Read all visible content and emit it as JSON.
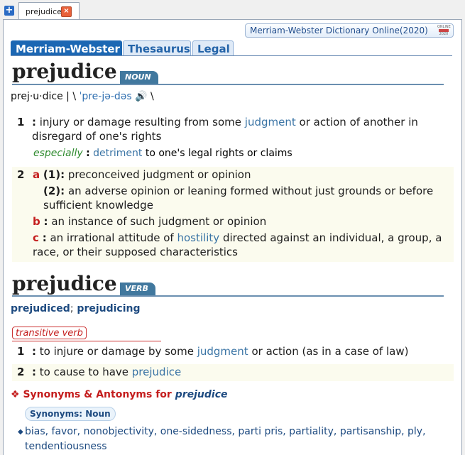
{
  "tabbar": {
    "new_tab_icon": "plus-icon",
    "tab_label": "prejudice",
    "close_icon": "close-icon"
  },
  "source_button": {
    "label": "Merriam-Webster Dictionary Online(2020)",
    "badge_top": "ONLINE",
    "badge_bottom": "2020"
  },
  "dict_tabs": [
    {
      "label": "Merriam-Webster",
      "active": true
    },
    {
      "label": "Thesaurus",
      "active": false
    },
    {
      "label": "Legal",
      "active": false
    }
  ],
  "entry1": {
    "headword": "prejudice",
    "pos": "NOUN",
    "pron": {
      "syllables": "prej·u·dice",
      "sep1": "|",
      "open": "\\",
      "ipa": "ˈpre-jə-dəs",
      "close": "\\",
      "speaker_icon": "speaker-icon"
    },
    "sense1": {
      "num": "1",
      "colon": ":",
      "text_before": "injury or damage resulting from some",
      "link": "judgment",
      "text_after": "or action of another in disregard of one's rights",
      "especially": "especially",
      "esp_colon": ":",
      "esp_link": "detriment",
      "esp_text": "to one's legal rights or claims"
    },
    "sense2": {
      "num": "2",
      "a": {
        "letter": "a",
        "sub1": "(1)",
        "colon": ":",
        "text1": "preconceived judgment or opinion",
        "sub2": "(2)",
        "text2": "an adverse opinion or leaning formed without just grounds or before sufficient knowledge"
      },
      "b": {
        "letter": "b",
        "colon": ":",
        "text": "an instance of such judgment or opinion"
      },
      "c": {
        "letter": "c",
        "colon": ":",
        "text_before": "an irrational attitude of",
        "link": "hostility",
        "text_after": "directed against an individual, a group, a race, or their supposed characteristics"
      }
    }
  },
  "entry2": {
    "headword": "prejudice",
    "pos": "VERB",
    "inflection1": "prejudiced",
    "inflection_sep": ";",
    "inflection2": "prejudicing",
    "verb_type": "transitive verb",
    "sense1": {
      "num": "1",
      "colon": ":",
      "text_before": "to injure or damage by some",
      "link": "judgment",
      "text_after": "or action (as in a case of law)"
    },
    "sense2": {
      "num": "2",
      "colon": ":",
      "text_before": "to cause to have",
      "link": "prejudice"
    }
  },
  "synonyms": {
    "icon": "diamond-cluster-icon",
    "heading": "Synonyms & Antonyms for",
    "heading_word": "prejudice",
    "pill": "Synonyms: Noun",
    "bullet_icon": "bullet-diamond-icon",
    "list": "bias, favor, nonobjectivity, one-sidedness, parti pris, partiality, partisanship, ply, tendentiousness"
  },
  "colors": {
    "accent_blue": "#1c67b3",
    "link_blue": "#3a74a5",
    "sense_red": "#c41d1d",
    "label_green": "#2d8a2d",
    "pos_tag": "#41789e"
  }
}
